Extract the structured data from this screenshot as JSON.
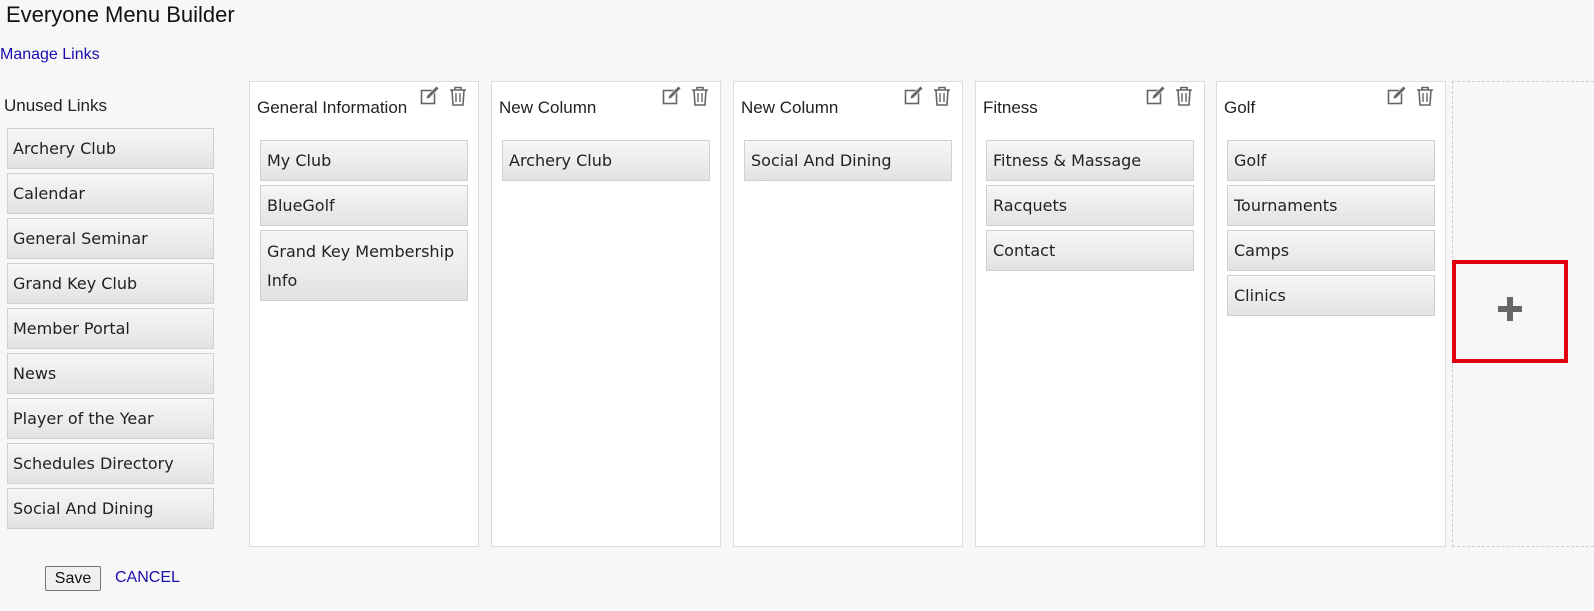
{
  "page": {
    "title": "Everyone Menu Builder",
    "manage_links": "Manage Links"
  },
  "unused": {
    "header": "Unused Links",
    "items": [
      "Archery Club",
      "Calendar",
      "General Seminar",
      "Grand Key Club",
      "Member Portal",
      "News",
      "Player of the Year",
      "Schedules Directory",
      "Social And Dining"
    ]
  },
  "columns": [
    {
      "title": "General Information",
      "items": [
        "My Club",
        "BlueGolf",
        "Grand Key Membership Info"
      ]
    },
    {
      "title": "New Column",
      "items": [
        "Archery Club"
      ]
    },
    {
      "title": "New Column",
      "items": [
        "Social And Dining"
      ]
    },
    {
      "title": "Fitness",
      "items": [
        "Fitness & Massage",
        "Racquets",
        "Contact"
      ]
    },
    {
      "title": "Golf",
      "items": [
        "Golf",
        "Tournaments",
        "Camps",
        "Clinics"
      ]
    }
  ],
  "actions": {
    "save": "Save",
    "cancel": "CANCEL"
  },
  "icons": {
    "edit": "edit-icon",
    "delete": "trash-icon",
    "add": "plus-icon"
  },
  "colors": {
    "link": "#1a0dab",
    "highlight_border": "#e3000f"
  }
}
